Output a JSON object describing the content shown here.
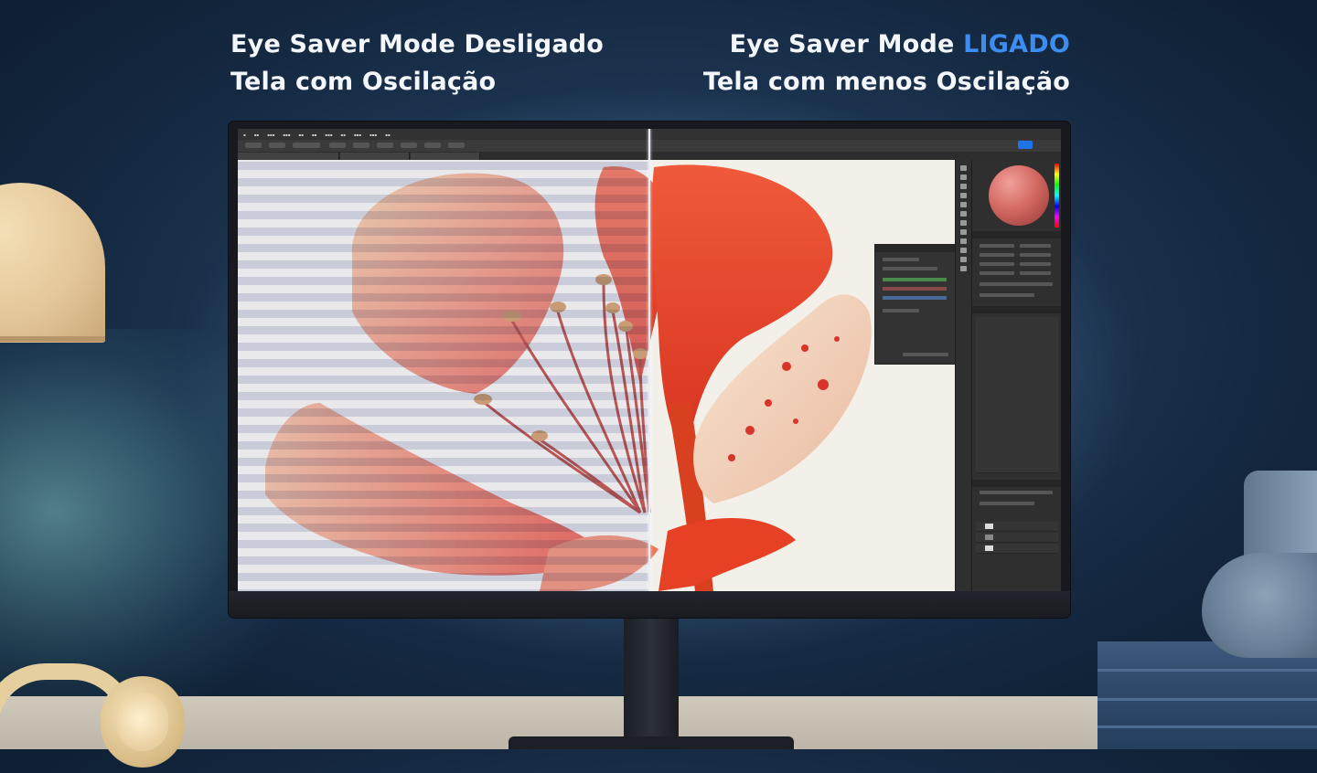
{
  "headline_left": {
    "line1": "Eye Saver Mode Desligado",
    "line2": "Tela com Oscilação"
  },
  "headline_right": {
    "line1_prefix": "Eye Saver Mode ",
    "line1_accent": "LIGADO",
    "line2": "Tela com menos Oscilação"
  },
  "colors": {
    "accent": "#3d8cf0",
    "headline": "#f3f6fa",
    "petal": "#e8452f",
    "background": "#1d3552"
  },
  "icons": {
    "lamp": "desk-lamp-icon",
    "headphones": "headphones-icon",
    "vase": "vase-icon"
  }
}
